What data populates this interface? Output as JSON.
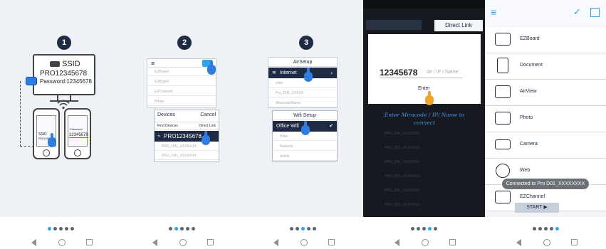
{
  "colors": {
    "navy": "#1f2a44",
    "accent_blue": "#2fa4e7",
    "panel_bg": "#eef1f6",
    "hand_blue": "#2f7de1",
    "hand_orange": "#f0a22a"
  },
  "page_indicator": {
    "active_index": [
      0,
      1,
      2,
      3,
      4
    ],
    "dot_count": 5
  },
  "screen1": {
    "step": "1",
    "ssid_label": "SSID",
    "device_id": "PRO12345678",
    "password_line": "Password:12345678",
    "phone_ssid": "SSID",
    "phone_ssid_value": "PRO12345678",
    "phone_password": "Password",
    "phone_password_value": "12345678"
  },
  "screen2": {
    "step": "2",
    "menu_items": [
      "EZBoard",
      "EZBoard",
      "EZChannel",
      "Photo"
    ],
    "devices_header": "Devices",
    "cancel": "Cancel",
    "find_devices": "Find Devices",
    "direct_link": "Direct Link",
    "device_selected": "PRO12345678",
    "device_row_2": "PRO_D01_XXXXXXX",
    "device_row_3": "PRO_D01_XXXXXXX"
  },
  "screen3": {
    "step": "3",
    "airsetup_title": "AirSetup",
    "internet": "Internet",
    "dim_rows": [
      "wlan",
      "Pro_D01_XXXXX",
      "Miracode/Name"
    ],
    "wifi_setup_title": "Wifi Setup",
    "office_wifi": "Office Wifi",
    "wifi_rows": [
      "Wlan",
      "Network",
      "Airlink"
    ]
  },
  "screen4": {
    "status_bar": "",
    "direct_link_button": "Direct Link",
    "entered_code": "12345678",
    "input_placeholder": "de / IP / Name",
    "enter_button": "Enter",
    "hint": "Enter Miracode / IP/ Name to connect",
    "list_rows": [
      "PRO_D01_XXXXXXX",
      "PRO_D01_XXXXXXX",
      "PRO_D01_XXXXXXX",
      "PRO_D01_XXXXXXX",
      "PRO_D01_XXXXXXX",
      "PRO_D01_XXXXXXX"
    ]
  },
  "screen5": {
    "menu_items": [
      "EZBoard",
      "Document",
      "AirView",
      "Photo",
      "Camera",
      "Web",
      "EZChannel"
    ],
    "icons": [
      "ezboard-icon",
      "document-icon",
      "airview-icon",
      "photo-icon",
      "camera-icon",
      "web-icon",
      "ezchannel-icon"
    ],
    "toast": "Connected to Pro D01_XXXXXXXX",
    "start_button": "START ▶"
  },
  "nav": {
    "icons": [
      "back-icon",
      "home-icon",
      "recents-icon"
    ]
  }
}
